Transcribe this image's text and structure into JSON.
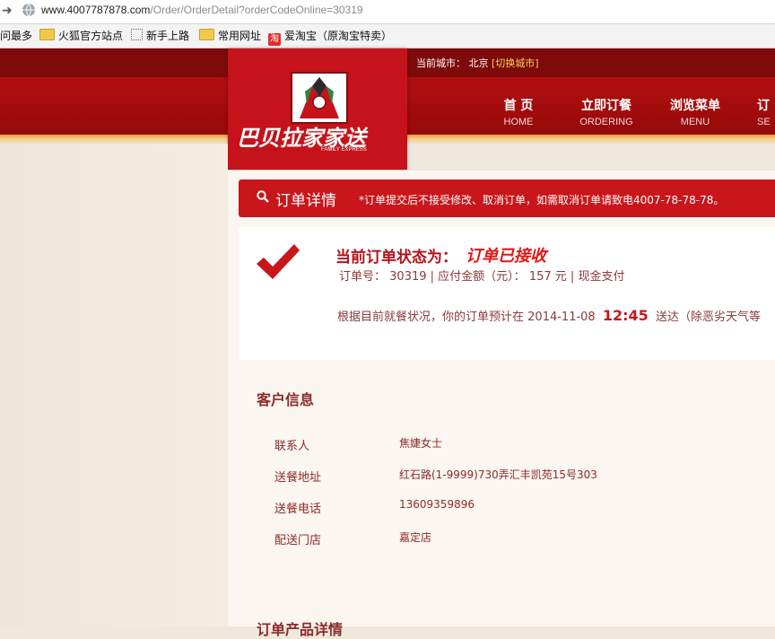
{
  "browser": {
    "url_host": "www.4007787878.com",
    "url_path": "/Order/OrderDetail?orderCodeOnline=30319",
    "bookmarks": [
      {
        "label": "问最多",
        "icon": "none"
      },
      {
        "label": "火狐官方站点",
        "icon": "folder-icon"
      },
      {
        "label": "新手上路",
        "icon": "page-icon"
      },
      {
        "label": "常用网址",
        "icon": "folder-icon"
      },
      {
        "label": "爱淘宝（原淘宝特卖）",
        "icon": "taobao-icon",
        "icon_text": "淘"
      }
    ]
  },
  "header": {
    "current_city_label": "当前城市：",
    "city": "北京",
    "switch_city": "[切换城市]",
    "logo_text": "巴贝拉家家送",
    "logo_sub": "FAMILY EXPRESS",
    "nav": [
      {
        "cn": "首 页",
        "en": "HOME"
      },
      {
        "cn": "立即订餐",
        "en": "ORDERING"
      },
      {
        "cn": "浏览菜单",
        "en": "MENU"
      },
      {
        "cn": "订",
        "en": "SE"
      }
    ]
  },
  "order_detail": {
    "title": "订单详情",
    "note": "*订单提交后不接受修改、取消订单，如需取消订单请致电4007-78-78-78。",
    "status_label": "当前订单状态为：",
    "status_value": "订单已接收",
    "order_no_label": "订单号：",
    "order_no": "30319",
    "amount_label": "应付金额（元）：",
    "amount": "157 元",
    "payment": "现金支付",
    "eta_prefix": "根据目前就餐状况，你的订单预计在",
    "eta_date": "2014-11-08",
    "eta_time": "12:45",
    "eta_suffix": "送达（除恶劣天气等"
  },
  "customer": {
    "title": "客户信息",
    "rows": [
      {
        "label": "联系人",
        "value": "焦婕女士"
      },
      {
        "label": "送餐地址",
        "value": "红石路(1-9999)730弄汇丰凯苑15号303"
      },
      {
        "label": "送餐电话",
        "value": "13609359896"
      },
      {
        "label": "配送门店",
        "value": "嘉定店"
      }
    ]
  },
  "products_title": "订单产品详情",
  "colors": {
    "brand_red": "#c8161b",
    "dark_red": "#7e0a0a",
    "gold": "#f7d25a"
  }
}
